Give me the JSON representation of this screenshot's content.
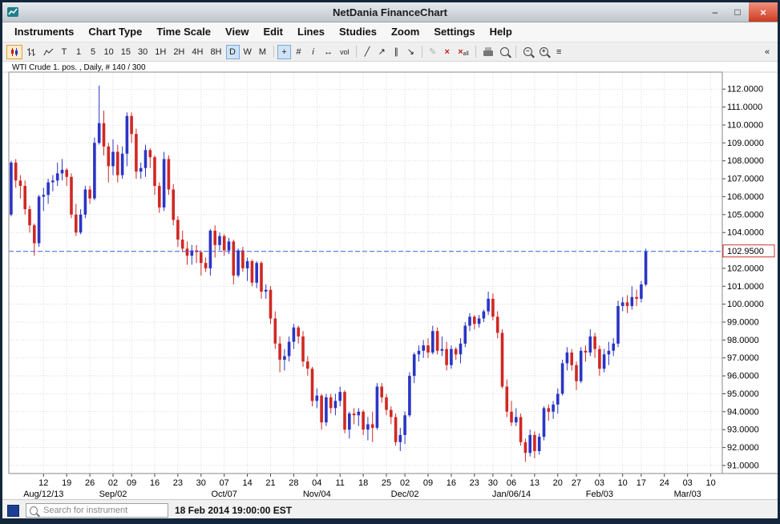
{
  "window": {
    "title": "NetDania FinanceChart"
  },
  "icons": {
    "titlebar_minimize": "–",
    "titlebar_maximize": "□",
    "titlebar_close": "×",
    "crosshair": "+",
    "grid": "#",
    "info": "i",
    "h_scale": "↔",
    "volume_label": "vol",
    "trendline": "╱",
    "ray": "↗",
    "channel": "∥",
    "arrow_line": "↘",
    "edit_lines": "✎",
    "delete_line": "×",
    "delete_all": "×",
    "delete_all_suffix": "all",
    "zoom_out_sign": "−",
    "zoom_in_sign": "+",
    "settings": "≡",
    "panel_toggle": "«"
  },
  "menu": {
    "items": [
      "Instruments",
      "Chart Type",
      "Time Scale",
      "View",
      "Edit",
      "Lines",
      "Studies",
      "Zoom",
      "Settings",
      "Help"
    ]
  },
  "toolbar": {
    "timeframes": [
      "T",
      "1",
      "5",
      "10",
      "15",
      "30",
      "1H",
      "2H",
      "4H",
      "8H",
      "D",
      "W",
      "M"
    ],
    "active_timeframe": "D"
  },
  "chart": {
    "instrument_label": "WTI Crude 1. pos. , Daily, # 140 / 300",
    "last_price_label": "102.9500",
    "colors": {
      "up": "#2a35c4",
      "down": "#d02823",
      "last_price_box_border": "#d03030"
    }
  },
  "statusbar": {
    "search_placeholder": "Search for instrument",
    "timestamp": "18 Feb 2014 19:00:00 EST"
  },
  "chart_data": {
    "type": "candlestick",
    "title": "WTI Crude 1. pos. Daily",
    "last_price": 102.95,
    "y_axis": {
      "render_min": 90.55,
      "render_max": 112.95,
      "tick_interval": 1.0,
      "tick_labels": [
        "112.0000",
        "111.0000",
        "110.0000",
        "109.0000",
        "108.0000",
        "107.0000",
        "106.0000",
        "105.0000",
        "104.0000",
        "102.0000",
        "101.0000",
        "100.0000",
        "99.0000",
        "98.0000",
        "97.0000",
        "96.0000",
        "95.0000",
        "94.0000",
        "93.0000",
        "92.0000",
        "91.0000"
      ]
    },
    "x_axis": {
      "total_slots": 154,
      "day_ticks": [
        [
          "12",
          7
        ],
        [
          "19",
          12
        ],
        [
          "26",
          17
        ],
        [
          "02",
          22
        ],
        [
          "09",
          26
        ],
        [
          "16",
          31
        ],
        [
          "23",
          36
        ],
        [
          "30",
          41
        ],
        [
          "07",
          46
        ],
        [
          "14",
          51
        ],
        [
          "21",
          56
        ],
        [
          "28",
          61
        ],
        [
          "04",
          66
        ],
        [
          "11",
          71
        ],
        [
          "18",
          76
        ],
        [
          "25",
          81
        ],
        [
          "02",
          85
        ],
        [
          "09",
          90
        ],
        [
          "16",
          95
        ],
        [
          "23",
          100
        ],
        [
          "30",
          104
        ],
        [
          "06",
          108
        ],
        [
          "13",
          113
        ],
        [
          "20",
          118
        ],
        [
          "27",
          122
        ],
        [
          "03",
          127
        ],
        [
          "10",
          132
        ],
        [
          "17",
          136
        ],
        [
          "24",
          141
        ],
        [
          "03",
          146
        ],
        [
          "10",
          151
        ]
      ],
      "month_labels": [
        [
          "Aug/12/13",
          7
        ],
        [
          "Sep/02",
          22
        ],
        [
          "Oct/07",
          46
        ],
        [
          "Nov/04",
          66
        ],
        [
          "Dec/02",
          85
        ],
        [
          "Jan/06/14",
          108
        ],
        [
          "Feb/03",
          127
        ],
        [
          "Mar/03",
          146
        ]
      ]
    },
    "candles": [
      [
        "Aug 01",
        105.0,
        108.0,
        104.9,
        107.9
      ],
      [
        "Aug 02",
        107.9,
        108.1,
        106.5,
        106.9
      ],
      [
        "Aug 05",
        106.9,
        107.2,
        105.9,
        106.6
      ],
      [
        "Aug 06",
        106.6,
        106.9,
        105.0,
        105.3
      ],
      [
        "Aug 07",
        105.3,
        105.5,
        104.0,
        104.4
      ],
      [
        "Aug 08",
        104.4,
        104.5,
        102.7,
        103.4
      ],
      [
        "Aug 09",
        103.4,
        106.1,
        103.2,
        106.0
      ],
      [
        "Aug 12",
        106.0,
        106.5,
        105.2,
        106.1
      ],
      [
        "Aug 13",
        106.1,
        107.0,
        105.6,
        106.8
      ],
      [
        "Aug 14",
        106.8,
        107.2,
        106.3,
        106.9
      ],
      [
        "Aug 15",
        106.9,
        107.9,
        106.6,
        107.3
      ],
      [
        "Aug 16",
        107.3,
        108.1,
        106.9,
        107.5
      ],
      [
        "Aug 19",
        107.5,
        107.6,
        106.6,
        107.1
      ],
      [
        "Aug 20",
        107.1,
        107.3,
        104.8,
        105.0
      ],
      [
        "Aug 21",
        105.0,
        105.6,
        103.8,
        104.0
      ],
      [
        "Aug 22",
        104.0,
        105.3,
        103.9,
        105.0
      ],
      [
        "Aug 23",
        105.0,
        106.6,
        104.8,
        106.4
      ],
      [
        "Aug 26",
        106.4,
        106.6,
        105.6,
        105.9
      ],
      [
        "Aug 27",
        105.9,
        109.3,
        105.8,
        109.0
      ],
      [
        "Aug 28",
        109.0,
        112.2,
        108.9,
        110.1
      ],
      [
        "Aug 29",
        110.1,
        110.8,
        108.3,
        108.8
      ],
      [
        "Aug 30",
        108.8,
        109.0,
        106.8,
        107.7
      ],
      [
        "Sep 03",
        107.7,
        109.2,
        107.2,
        108.5
      ],
      [
        "Sep 04",
        108.5,
        108.9,
        106.8,
        107.2
      ],
      [
        "Sep 05",
        107.2,
        108.8,
        107.0,
        108.4
      ],
      [
        "Sep 06",
        108.4,
        110.7,
        107.7,
        110.5
      ],
      [
        "Sep 09",
        110.5,
        110.7,
        109.0,
        109.5
      ],
      [
        "Sep 10",
        109.5,
        109.8,
        107.0,
        107.4
      ],
      [
        "Sep 11",
        107.4,
        107.9,
        107.0,
        107.6
      ],
      [
        "Sep 12",
        107.6,
        108.9,
        107.1,
        108.6
      ],
      [
        "Sep 13",
        108.6,
        108.7,
        107.6,
        108.2
      ],
      [
        "Sep 16",
        108.2,
        108.3,
        106.1,
        106.6
      ],
      [
        "Sep 17",
        106.6,
        106.8,
        105.1,
        105.4
      ],
      [
        "Sep 18",
        105.4,
        108.5,
        105.2,
        108.1
      ],
      [
        "Sep 19",
        108.1,
        108.3,
        106.1,
        106.4
      ],
      [
        "Sep 20",
        106.4,
        106.7,
        104.4,
        104.7
      ],
      [
        "Sep 23",
        104.7,
        104.9,
        103.2,
        103.6
      ],
      [
        "Sep 24",
        103.6,
        104.1,
        102.9,
        103.1
      ],
      [
        "Sep 25",
        103.1,
        103.5,
        102.2,
        102.7
      ],
      [
        "Sep 26",
        102.7,
        103.3,
        102.2,
        103.0
      ],
      [
        "Sep 27",
        103.0,
        103.3,
        102.3,
        102.9
      ],
      [
        "Sep 30",
        102.9,
        103.0,
        101.6,
        102.3
      ],
      [
        "Oct 01",
        102.3,
        102.6,
        101.8,
        102.0
      ],
      [
        "Oct 02",
        102.0,
        104.2,
        101.6,
        104.1
      ],
      [
        "Oct 03",
        104.1,
        104.4,
        102.6,
        103.3
      ],
      [
        "Oct 04",
        103.3,
        104.0,
        103.0,
        103.8
      ],
      [
        "Oct 07",
        103.8,
        103.9,
        102.7,
        103.0
      ],
      [
        "Oct 08",
        103.0,
        103.7,
        102.8,
        103.5
      ],
      [
        "Oct 09",
        103.5,
        103.6,
        101.1,
        101.6
      ],
      [
        "Oct 10",
        101.6,
        103.1,
        101.5,
        103.0
      ],
      [
        "Oct 11",
        103.0,
        103.2,
        101.8,
        102.0
      ],
      [
        "Oct 14",
        102.0,
        102.6,
        101.3,
        102.4
      ],
      [
        "Oct 15",
        102.4,
        102.5,
        101.0,
        101.2
      ],
      [
        "Oct 16",
        101.2,
        102.4,
        100.9,
        102.3
      ],
      [
        "Oct 17",
        102.3,
        102.4,
        100.3,
        100.7
      ],
      [
        "Oct 18",
        100.7,
        101.1,
        100.3,
        100.8
      ],
      [
        "Oct 21",
        100.8,
        101.0,
        98.9,
        99.2
      ],
      [
        "Oct 22",
        99.2,
        99.6,
        97.5,
        97.8
      ],
      [
        "Oct 23",
        97.8,
        98.2,
        96.2,
        96.9
      ],
      [
        "Oct 24",
        96.9,
        97.5,
        96.3,
        97.1
      ],
      [
        "Oct 25",
        97.1,
        98.2,
        96.8,
        97.9
      ],
      [
        "Oct 28",
        97.9,
        98.9,
        97.5,
        98.7
      ],
      [
        "Oct 29",
        98.7,
        98.8,
        97.8,
        98.2
      ],
      [
        "Oct 30",
        98.2,
        98.5,
        96.5,
        96.8
      ],
      [
        "Oct 31",
        96.8,
        97.1,
        96.0,
        96.4
      ],
      [
        "Nov 01",
        96.4,
        96.5,
        94.3,
        94.6
      ],
      [
        "Nov 04",
        94.6,
        95.3,
        94.2,
        94.9
      ],
      [
        "Nov 05",
        94.9,
        95.0,
        93.0,
        93.4
      ],
      [
        "Nov 06",
        93.4,
        95.0,
        93.2,
        94.8
      ],
      [
        "Nov 07",
        94.8,
        95.0,
        93.9,
        94.2
      ],
      [
        "Nov 08",
        94.2,
        95.0,
        93.8,
        94.6
      ],
      [
        "Nov 11",
        94.6,
        95.4,
        94.3,
        95.1
      ],
      [
        "Nov 12",
        95.1,
        95.2,
        92.8,
        93.0
      ],
      [
        "Nov 13",
        93.0,
        94.0,
        92.5,
        93.9
      ],
      [
        "Nov 14",
        93.9,
        94.2,
        93.3,
        93.8
      ],
      [
        "Nov 15",
        93.8,
        94.2,
        93.2,
        94.0
      ],
      [
        "Nov 18",
        94.0,
        94.1,
        92.7,
        93.0
      ],
      [
        "Nov 19",
        93.0,
        93.7,
        92.4,
        93.3
      ],
      [
        "Nov 20",
        93.3,
        94.0,
        92.3,
        93.1
      ],
      [
        "Nov 21",
        93.1,
        95.6,
        93.0,
        95.4
      ],
      [
        "Nov 22",
        95.4,
        95.6,
        94.5,
        94.8
      ],
      [
        "Nov 25",
        94.8,
        95.0,
        93.8,
        94.1
      ],
      [
        "Nov 26",
        94.1,
        94.3,
        93.3,
        93.7
      ],
      [
        "Nov 27",
        93.7,
        93.9,
        92.1,
        92.3
      ],
      [
        "Nov 29",
        92.3,
        93.1,
        91.8,
        92.7
      ],
      [
        "Dec 02",
        92.7,
        94.0,
        92.2,
        93.8
      ],
      [
        "Dec 03",
        93.8,
        96.2,
        93.7,
        96.0
      ],
      [
        "Dec 04",
        96.0,
        97.3,
        95.6,
        97.2
      ],
      [
        "Dec 05",
        97.2,
        97.7,
        96.8,
        97.4
      ],
      [
        "Dec 06",
        97.4,
        98.0,
        97.0,
        97.7
      ],
      [
        "Dec 09",
        97.7,
        98.1,
        97.0,
        97.3
      ],
      [
        "Dec 10",
        97.3,
        98.8,
        97.2,
        98.5
      ],
      [
        "Dec 11",
        98.5,
        98.7,
        97.2,
        97.4
      ],
      [
        "Dec 12",
        97.4,
        98.2,
        97.1,
        97.5
      ],
      [
        "Dec 13",
        97.5,
        97.9,
        96.3,
        96.6
      ],
      [
        "Dec 16",
        96.6,
        97.7,
        96.4,
        97.5
      ],
      [
        "Dec 17",
        97.5,
        97.6,
        96.9,
        97.2
      ],
      [
        "Dec 18",
        97.2,
        98.1,
        96.7,
        97.8
      ],
      [
        "Dec 19",
        97.8,
        99.0,
        97.6,
        98.8
      ],
      [
        "Dec 20",
        98.8,
        99.5,
        98.5,
        99.3
      ],
      [
        "Dec 23",
        99.3,
        99.4,
        98.6,
        98.9
      ],
      [
        "Dec 24",
        98.9,
        99.4,
        98.7,
        99.2
      ],
      [
        "Dec 26",
        99.2,
        99.7,
        99.0,
        99.6
      ],
      [
        "Dec 27",
        99.6,
        100.7,
        99.4,
        100.3
      ],
      [
        "Dec 30",
        100.3,
        100.6,
        99.1,
        99.3
      ],
      [
        "Dec 31",
        99.3,
        99.6,
        98.1,
        98.4
      ],
      [
        "Jan 02",
        98.4,
        98.6,
        95.3,
        95.4
      ],
      [
        "Jan 03",
        95.4,
        95.8,
        93.7,
        94.0
      ],
      [
        "Jan 06",
        94.0,
        94.6,
        93.2,
        93.4
      ],
      [
        "Jan 07",
        93.4,
        94.2,
        93.2,
        93.7
      ],
      [
        "Jan 08",
        93.7,
        93.9,
        92.1,
        92.3
      ],
      [
        "Jan 09",
        92.3,
        92.5,
        91.2,
        91.7
      ],
      [
        "Jan 10",
        91.7,
        93.0,
        91.5,
        92.7
      ],
      [
        "Jan 13",
        92.7,
        92.9,
        91.4,
        91.8
      ],
      [
        "Jan 14",
        91.8,
        92.8,
        91.6,
        92.6
      ],
      [
        "Jan 15",
        92.6,
        94.3,
        92.4,
        94.2
      ],
      [
        "Jan 16",
        94.2,
        94.4,
        93.5,
        94.0
      ],
      [
        "Jan 17",
        94.0,
        94.6,
        93.6,
        94.4
      ],
      [
        "Jan 21",
        94.4,
        95.3,
        93.9,
        95.0
      ],
      [
        "Jan 22",
        95.0,
        96.9,
        94.9,
        96.7
      ],
      [
        "Jan 23",
        96.7,
        97.6,
        96.3,
        97.3
      ],
      [
        "Jan 24",
        97.3,
        97.5,
        96.3,
        96.6
      ],
      [
        "Jan 27",
        96.6,
        96.8,
        95.2,
        95.7
      ],
      [
        "Jan 28",
        95.7,
        97.6,
        95.6,
        97.4
      ],
      [
        "Jan 29",
        97.4,
        97.7,
        96.8,
        97.3
      ],
      [
        "Jan 30",
        97.3,
        98.6,
        97.1,
        98.2
      ],
      [
        "Jan 31",
        98.2,
        98.4,
        97.0,
        97.5
      ],
      [
        "Feb 03",
        97.5,
        97.7,
        96.0,
        96.4
      ],
      [
        "Feb 04",
        96.4,
        97.5,
        96.2,
        97.2
      ],
      [
        "Feb 05",
        97.2,
        97.9,
        96.6,
        97.4
      ],
      [
        "Feb 06",
        97.4,
        98.1,
        97.1,
        97.8
      ],
      [
        "Feb 07",
        97.8,
        100.2,
        97.6,
        99.9
      ],
      [
        "Feb 10",
        99.9,
        100.4,
        99.6,
        100.1
      ],
      [
        "Feb 11",
        100.1,
        100.5,
        99.5,
        99.9
      ],
      [
        "Feb 12",
        99.9,
        101.0,
        99.7,
        100.4
      ],
      [
        "Feb 13",
        100.4,
        100.8,
        99.9,
        100.3
      ],
      [
        "Feb 14",
        100.3,
        101.3,
        100.1,
        101.1
      ],
      [
        "Feb 18",
        101.1,
        103.1,
        101.0,
        102.95
      ]
    ]
  }
}
